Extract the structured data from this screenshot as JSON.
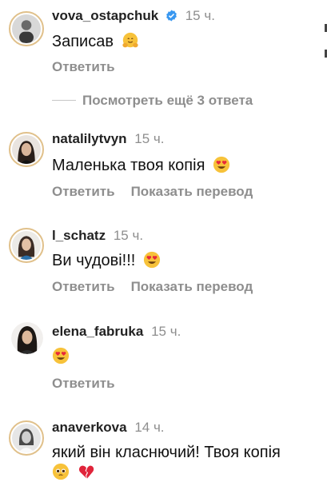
{
  "comments": [
    {
      "username": "vova_ostapchuk",
      "time": "15 ч.",
      "verified": true,
      "text": "Записав",
      "emoji": [
        "hug"
      ],
      "actions": [
        "Ответить"
      ]
    },
    {
      "username": "natalilytvyn",
      "time": "15 ч.",
      "text": "Маленька твоя копія",
      "emoji": [
        "heart-eyes"
      ],
      "actions": [
        "Ответить",
        "Показать перевод"
      ]
    },
    {
      "username": "l_schatz",
      "time": "15 ч.",
      "text": "Ви чудові!!!",
      "emoji": [
        "heart-eyes"
      ],
      "actions": [
        "Ответить",
        "Показать перевод"
      ]
    },
    {
      "username": "elena_fabruka",
      "time": "15 ч.",
      "text": "",
      "emoji": [
        "heart-eyes"
      ],
      "actions": [
        "Ответить"
      ]
    },
    {
      "username": "anaverkova",
      "time": "14 ч.",
      "text": "який він класнючий! Твоя копія",
      "emoji": [
        "pleading",
        "broken-heart"
      ]
    }
  ],
  "replies_link": "Посмотреть ещё 3 ответа",
  "colors": {
    "secondary": "#8e8e8e",
    "verified": "#3897f0",
    "ring": "#e0c08a"
  }
}
